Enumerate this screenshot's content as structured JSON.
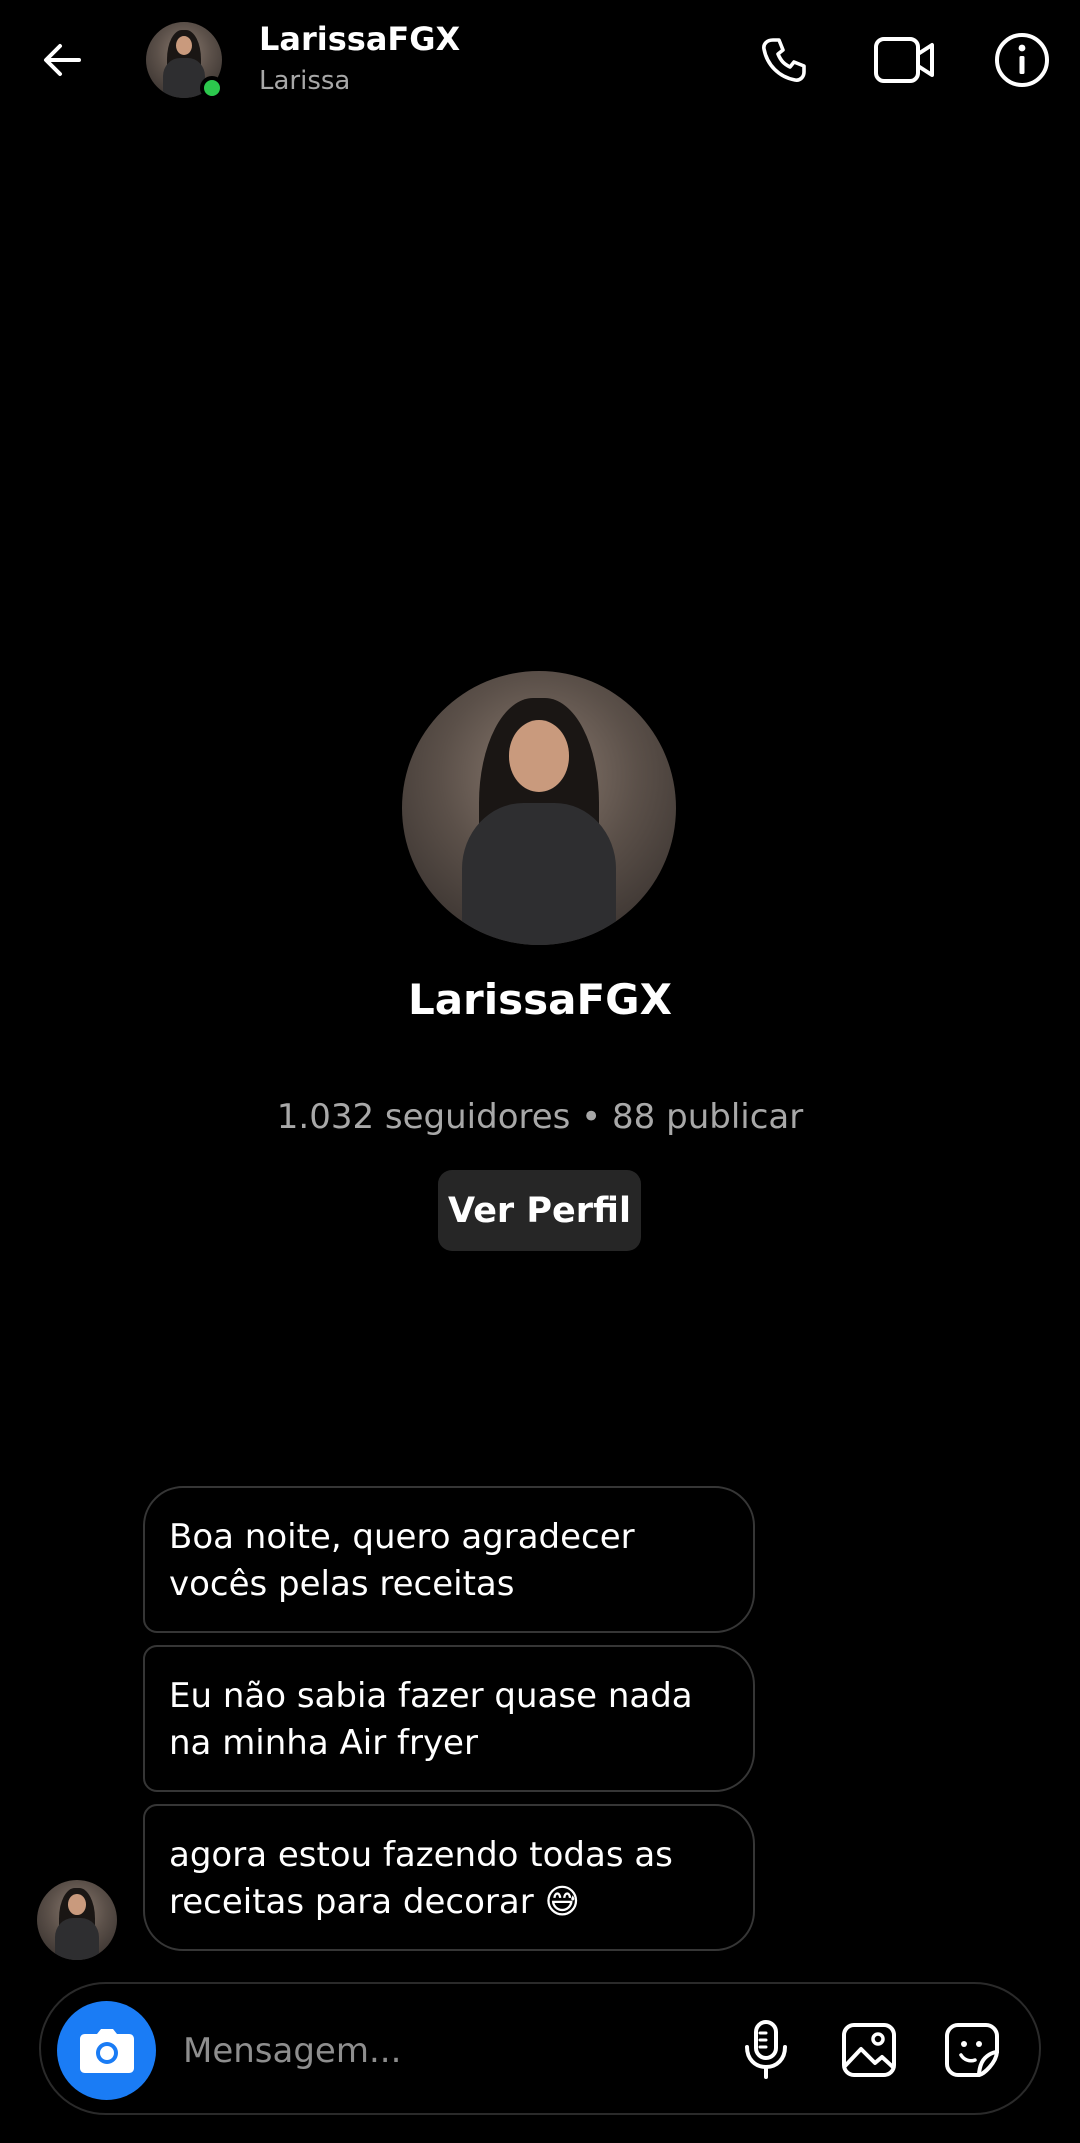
{
  "header": {
    "title": "LarissaFGX",
    "subtitle": "Larissa",
    "online_status_color": "#2cc84d",
    "icons": {
      "back": "back-arrow-icon",
      "call": "phone-icon",
      "video": "video-camera-icon",
      "info": "info-icon"
    }
  },
  "profile": {
    "name": "LarissaFGX",
    "stats": "1.032 seguidores • 88 publicar",
    "view_profile_label": "Ver Perfil"
  },
  "messages": [
    {
      "lines": [
        "Boa noite, quero agradecer",
        "vocês pelas receitas"
      ]
    },
    {
      "lines": [
        "Eu não sabia fazer quase nada",
        "na minha Air fryer"
      ]
    },
    {
      "lines": [
        "agora estou fazendo todas as",
        "receitas para decorar 😅"
      ]
    }
  ],
  "composer": {
    "placeholder": "Mensagem...",
    "camera_button_color": "#1a7cf5",
    "icons": {
      "camera": "camera-icon",
      "mic": "microphone-icon",
      "gallery": "image-gallery-icon",
      "sticker": "sticker-icon"
    }
  },
  "colors": {
    "background": "#000000",
    "bubble_border": "#363636",
    "secondary_text": "#a8a8a8",
    "button_background": "#262626"
  }
}
